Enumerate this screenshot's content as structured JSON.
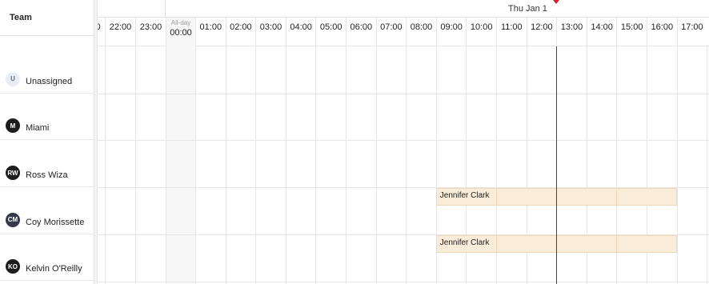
{
  "sidebar": {
    "header": "Team",
    "members": [
      {
        "initials": "U",
        "name": "Unassigned",
        "style": "light"
      },
      {
        "initials": "M",
        "name": "Miami",
        "style": "dark"
      },
      {
        "initials": "RW",
        "name": "Ross Wiza",
        "style": "dark"
      },
      {
        "initials": "CM",
        "name": "Coy Morissette",
        "style": "slate"
      },
      {
        "initials": "KO",
        "name": "Kelvin O'Reilly",
        "style": "dark"
      }
    ]
  },
  "timeline": {
    "date_label": "Thu Jan 1",
    "partial_hour": "0",
    "hours_before": [
      "22:00",
      "23:00"
    ],
    "allday": {
      "top": "All-day",
      "bottom": "00:00"
    },
    "hours_after": [
      "01:00",
      "02:00",
      "03:00",
      "04:00",
      "05:00",
      "06:00",
      "07:00",
      "08:00",
      "09:00",
      "10:00",
      "11:00",
      "12:00",
      "13:00",
      "14:00",
      "15:00",
      "16:00",
      "17:00"
    ]
  },
  "events": [
    {
      "title": "Jennifer Clark",
      "row": 3,
      "start": "09:00",
      "end": "17:00"
    },
    {
      "title": "Jennifer Clark",
      "row": 4,
      "start": "09:00",
      "end": "17:00"
    }
  ],
  "colors": {
    "event_bg": "#f9ecd9",
    "now_line": "#b3141b",
    "now_marker": "#d3242c"
  }
}
